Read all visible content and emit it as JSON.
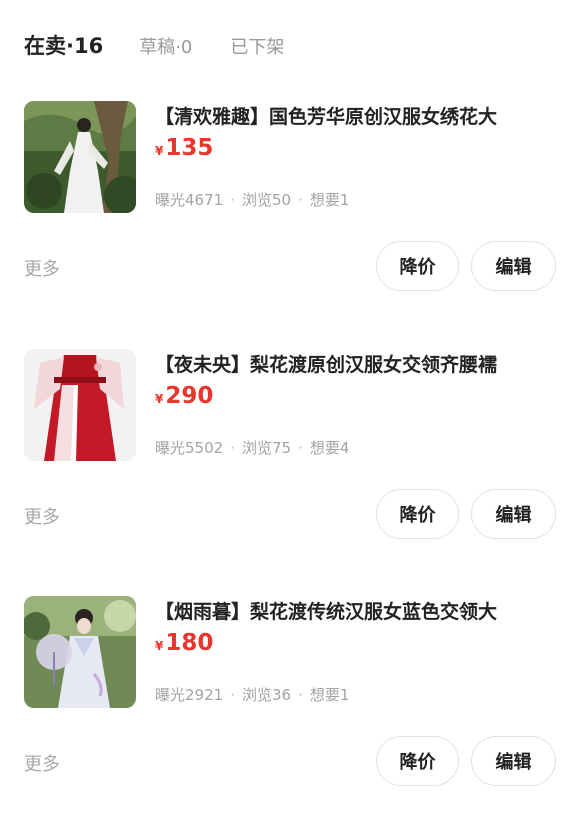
{
  "tabs": [
    {
      "label": "在卖·16"
    },
    {
      "label": "草稿·0"
    },
    {
      "label": "已下架"
    }
  ],
  "items": [
    {
      "title": "【清欢雅趣】国色芳华原创汉服女绣花大",
      "currency": "¥",
      "price": "135",
      "exposure": "曝光4671",
      "views": "浏览50",
      "wants": "想要1",
      "more_label": "更多",
      "reduce_label": "降价",
      "edit_label": "编辑"
    },
    {
      "title": "【夜未央】梨花渡原创汉服女交领齐腰襦",
      "currency": "¥",
      "price": "290",
      "exposure": "曝光5502",
      "views": "浏览75",
      "wants": "想要4",
      "more_label": "更多",
      "reduce_label": "降价",
      "edit_label": "编辑"
    },
    {
      "title": "【烟雨暮】梨花渡传统汉服女蓝色交领大",
      "currency": "¥",
      "price": "180",
      "exposure": "曝光2921",
      "views": "浏览36",
      "wants": "想要1",
      "more_label": "更多",
      "reduce_label": "降价",
      "edit_label": "编辑"
    }
  ],
  "colors": {
    "price": "#e8352e",
    "active_tab": "#222222",
    "inactive_tab": "#9a9a9a",
    "meta_text": "#a3a3a3"
  }
}
